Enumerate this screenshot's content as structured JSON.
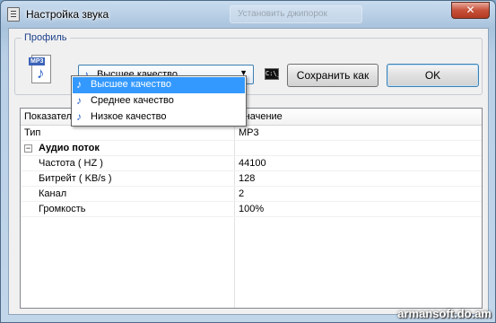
{
  "window": {
    "title": "Настройка звука",
    "close_label": "✕",
    "background_ghost_text": "Установить джипорок"
  },
  "profile": {
    "group_label": "Профиль",
    "file_icon_label": "MP3",
    "selected": "Высшее качество",
    "options": [
      "Высшее качество",
      "Среднее качество",
      "Низкое качество"
    ],
    "cmd_icon_label": "C:\\_",
    "save_as_label": "Сохранить как",
    "ok_label": "OK"
  },
  "table": {
    "headers": [
      "Показател",
      "Значение"
    ],
    "rows": [
      {
        "name": "Тип",
        "value": "MP3"
      },
      {
        "group": "Аудио поток"
      },
      {
        "name": "Частота ( HZ )",
        "value": "44100"
      },
      {
        "name": "Битрейт ( KB/s )",
        "value": "128"
      },
      {
        "name": "Канал",
        "value": "2"
      },
      {
        "name": "Громкость",
        "value": "100%"
      }
    ]
  },
  "watermark": "armansoft.do.am",
  "colors": {
    "selection": "#3399ff",
    "group_label": "#1b3f8a",
    "close_button": "#c7503a"
  }
}
